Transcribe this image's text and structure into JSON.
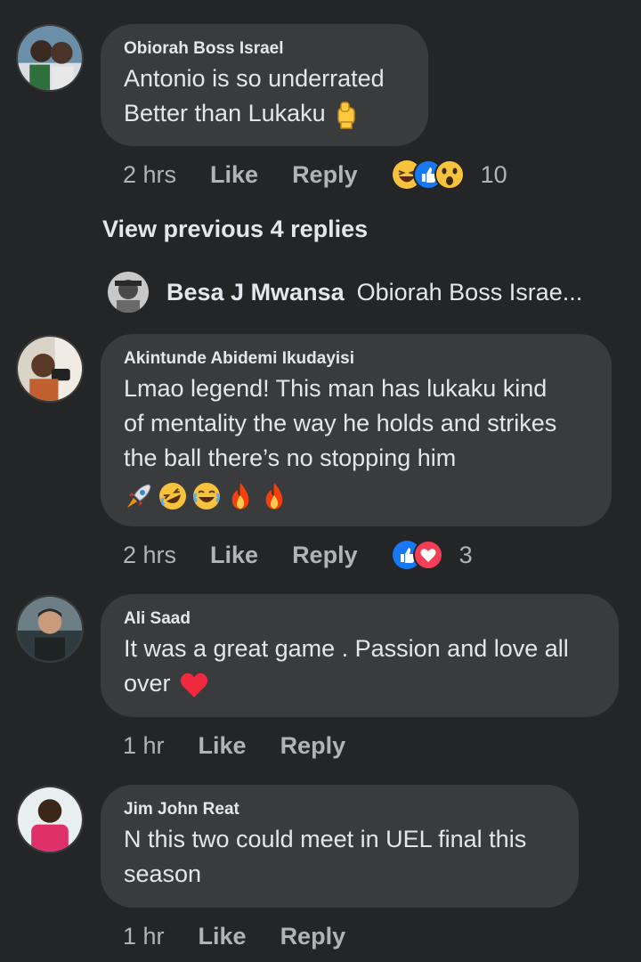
{
  "comments": [
    {
      "author": "Obiorah Boss Israel",
      "lines": [
        "Antonio is so underrated",
        "Better than Lukaku"
      ],
      "time": "2 hrs",
      "like": "Like",
      "reply": "Reply",
      "reactions": [
        "haha-icon",
        "like-icon",
        "wow-icon"
      ],
      "reaction_count": "10"
    },
    {
      "author": "Akintunde Abidemi Ikudayisi",
      "lines": [
        "Lmao legend! This man has lukaku kind",
        "of mentality the way he holds and strikes",
        "the ball there’s no stopping him"
      ],
      "emojis": [
        "rocket-emoji",
        "rofl-emoji",
        "joy-emoji",
        "fire-emoji",
        "fire-emoji"
      ],
      "time": "2 hrs",
      "like": "Like",
      "reply": "Reply",
      "reactions": [
        "like-icon",
        "love-icon"
      ],
      "reaction_count": "3"
    },
    {
      "author": "Ali Saad",
      "lines": [
        "It was a great game . Passion and love all",
        "over"
      ],
      "time": "1 hr",
      "like": "Like",
      "reply": "Reply"
    },
    {
      "author": "Jim John Reat",
      "lines": [
        "N this two could meet in UEL final this",
        "season"
      ],
      "time": "1 hr",
      "like": "Like",
      "reply": "Reply"
    }
  ],
  "view_previous": "View previous 4 replies",
  "reply_preview": {
    "author": "Besa J Mwansa",
    "text": "Obiorah Boss Israe..."
  },
  "colors": {
    "background": "#242526",
    "bubble": "#3a3b3c",
    "text": "#e4e6eb",
    "secondary_text": "#b0b3b8",
    "like_blue": "#1877f2",
    "love_red": "#f33e58"
  }
}
